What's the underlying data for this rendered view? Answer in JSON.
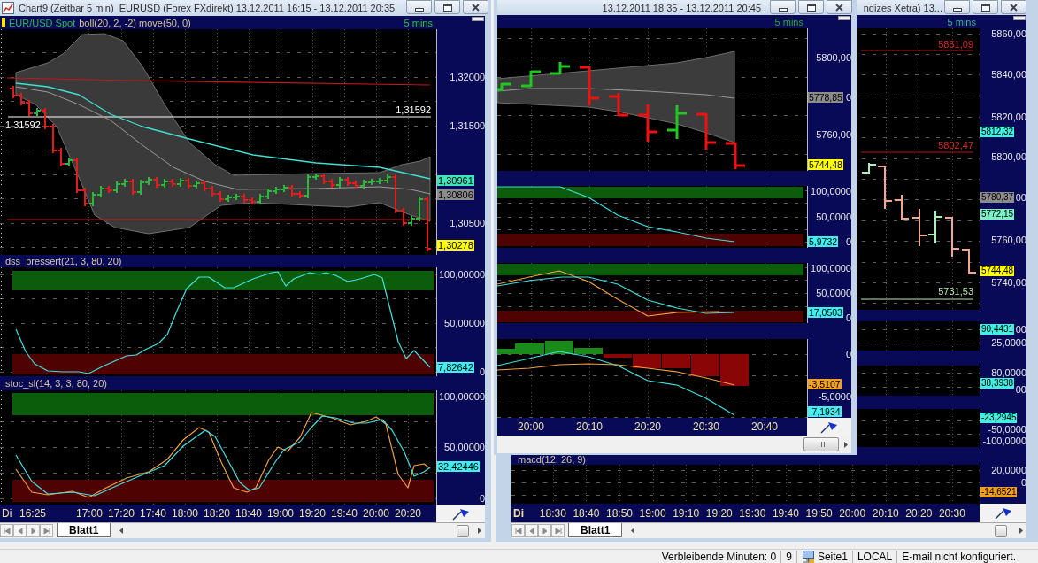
{
  "windows": [
    {
      "title": "Chart9 (Zeitbar 5 min)  EURUSD (Forex FXdirekt) 13.12.2011 16:15 - 13.12.2011 20:35",
      "active": true,
      "legend": [
        {
          "text": "EUR/USD Spot",
          "color": "#2fb84a"
        },
        {
          "text": "boll(20, 2, -2) move(50, 0)",
          "color": "#d6c48e"
        }
      ],
      "interval": "5 mins",
      "panels": [
        {
          "axis_labels": [
            "1,32000",
            "1,31500",
            "1,30500"
          ],
          "value_tags": [
            {
              "text": "1,30961",
              "color": "#3fe3bc"
            },
            {
              "text": "1,30806",
              "color": "#8c8c8c"
            },
            {
              "text": "1,30278",
              "color": "#ffff00"
            }
          ],
          "line_labels": [
            {
              "text": "1,31592",
              "color": "#ffffff"
            },
            {
              "text": "1,31592",
              "color": "#ffffff"
            }
          ]
        },
        {
          "title": "dss_bressert(21, 3, 80, 20)",
          "axis_labels": [
            "100,00000",
            "50,00000",
            "0"
          ],
          "value_tags": [
            {
              "text": "7,82642",
              "color": "#40f0f0"
            }
          ]
        },
        {
          "title": "stoc_sl(14, 3, 3, 80, 20)",
          "axis_labels": [
            "100,00000",
            "50,00000",
            "0"
          ],
          "value_tags": [
            {
              "text": "32,42446",
              "color": "#40f0f0"
            }
          ]
        }
      ],
      "time_axis": {
        "day": "Di",
        "times": [
          "16:25",
          "17:00",
          "17:20",
          "17:40",
          "18:00",
          "18:20",
          "18:40",
          "19:00",
          "19:20",
          "19:40",
          "20:00",
          "20:20"
        ]
      },
      "sheet_tabs": [
        {
          "label": "Blatt1",
          "selected": true
        }
      ]
    },
    {
      "title": "13.12.2011 18:35 - 13.12.2011 20:45",
      "active": false,
      "interval": "5 mins",
      "panels": [
        {
          "axis_labels": [
            "5800,00",
            "0",
            "5760,00"
          ],
          "value_tags": [
            {
              "text": "5778,85",
              "color": "#8c8c8c"
            },
            {
              "text": "5744,48",
              "color": "#ffff00"
            }
          ]
        },
        {
          "axis_labels": [
            "100,0000",
            "50,0000",
            "0"
          ],
          "value_tags": [
            {
              "text": "5,9732",
              "color": "#40f0f0"
            }
          ]
        },
        {
          "axis_labels": [
            "100,0000",
            "50,0000",
            "0"
          ],
          "value_tags": [
            {
              "text": "17,0503",
              "color": "#40f0f0"
            }
          ]
        },
        {
          "axis_labels": [
            "0",
            "-5,0000"
          ],
          "value_tags": [
            {
              "text": "-3,5107",
              "color": "#f0a020"
            },
            {
              "text": "-7,1934",
              "color": "#40f0f0"
            }
          ]
        }
      ],
      "time_axis": {
        "times": [
          "20:00",
          "20:10",
          "20:20",
          "20:30",
          "20:40"
        ]
      }
    },
    {
      "title": "ndizes Xetra) 13...",
      "active": false,
      "interval": "5 mins",
      "panels": [
        {
          "axis_labels": [
            "5860,00",
            "5840,00",
            "5820,00",
            "5800,00",
            "00",
            "5760,00",
            "5740,00"
          ],
          "value_tags": [
            {
              "text": "5812,32",
              "color": "#40f0e0"
            },
            {
              "text": "5780,37",
              "color": "#8c8c8c"
            },
            {
              "text": "5772,15",
              "color": "#80f0c8"
            },
            {
              "text": "5744,48",
              "color": "#ffff00"
            }
          ],
          "line_labels": [
            {
              "text": "5851,09",
              "color": "#d42a2a"
            },
            {
              "text": "5802,47",
              "color": "#d42a2a"
            },
            {
              "text": "5731,53",
              "color": "#b8e4b0"
            }
          ]
        },
        {
          "axis_labels": [
            "00",
            "25,0000"
          ],
          "value_tags": [
            {
              "text": "90,4431",
              "color": "#40f0e0"
            }
          ]
        },
        {
          "axis_labels": [
            "80,0000",
            "00"
          ],
          "value_tags": [
            {
              "text": "38,3938",
              "color": "#40f0e0"
            }
          ]
        },
        {
          "axis_labels": [
            "-50,0000",
            "-100,0000"
          ],
          "value_tags": [
            {
              "text": "-23,2945",
              "color": "#40f0e0"
            }
          ]
        },
        {
          "title": "macd(12, 26, 9)",
          "axis_labels": [
            "20,0000",
            "0"
          ],
          "value_tags": [
            {
              "text": "-14,6521",
              "color": "#f0a020"
            }
          ]
        }
      ],
      "time_axis": {
        "day": "Di",
        "times": [
          "18:30",
          "18:40",
          "18:50",
          "19:00",
          "19:10",
          "19:20",
          "19:30",
          "19:40",
          "19:50",
          "20:00",
          "20:10",
          "20:20",
          "20:30"
        ]
      },
      "sheet_tabs": [
        {
          "label": "Blatt1",
          "selected": true
        }
      ]
    }
  ],
  "status_bar": [
    {
      "kind": "text",
      "text": "Verbleibende Minuten: 0"
    },
    {
      "kind": "text",
      "text": "9"
    },
    {
      "kind": "page",
      "text": "Seite1"
    },
    {
      "kind": "text",
      "text": "LOCAL"
    },
    {
      "kind": "text",
      "text": "E-mail nicht konfiguriert."
    }
  ]
}
